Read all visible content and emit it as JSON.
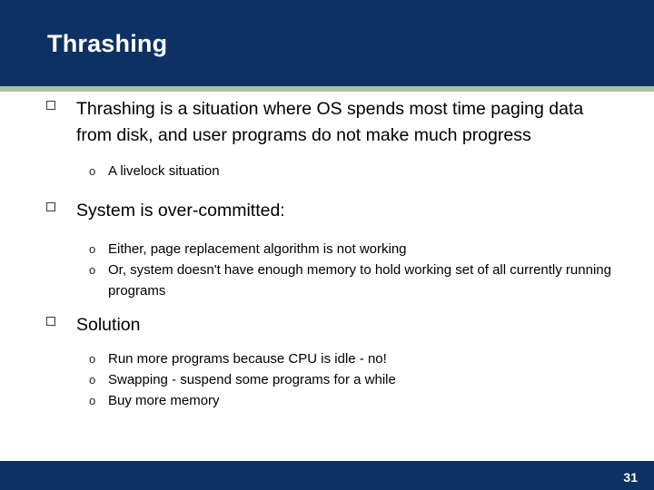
{
  "slide": {
    "title": "Thrashing",
    "page_number": "31",
    "colors": {
      "header_background": "#0e3163",
      "header_rule": "#a8c3a0",
      "footer_background": "#0e3163",
      "text": "#000000"
    },
    "bullets": [
      {
        "text": "Thrashing is a situation where OS spends most time paging data from disk, and user programs do not make much progress",
        "sub": [
          "A livelock situation"
        ]
      },
      {
        "text": "System is over-committed:",
        "sub": [
          "Either, page replacement algorithm is not working",
          "Or, system doesn't have enough memory to hold working set of all currently running programs"
        ]
      },
      {
        "text": "Solution",
        "sub": [
          "Run more programs because CPU is idle - no!",
          "Swapping - suspend some programs for a while",
          "Buy more memory"
        ]
      }
    ],
    "sub_bullet_marker": "o"
  }
}
